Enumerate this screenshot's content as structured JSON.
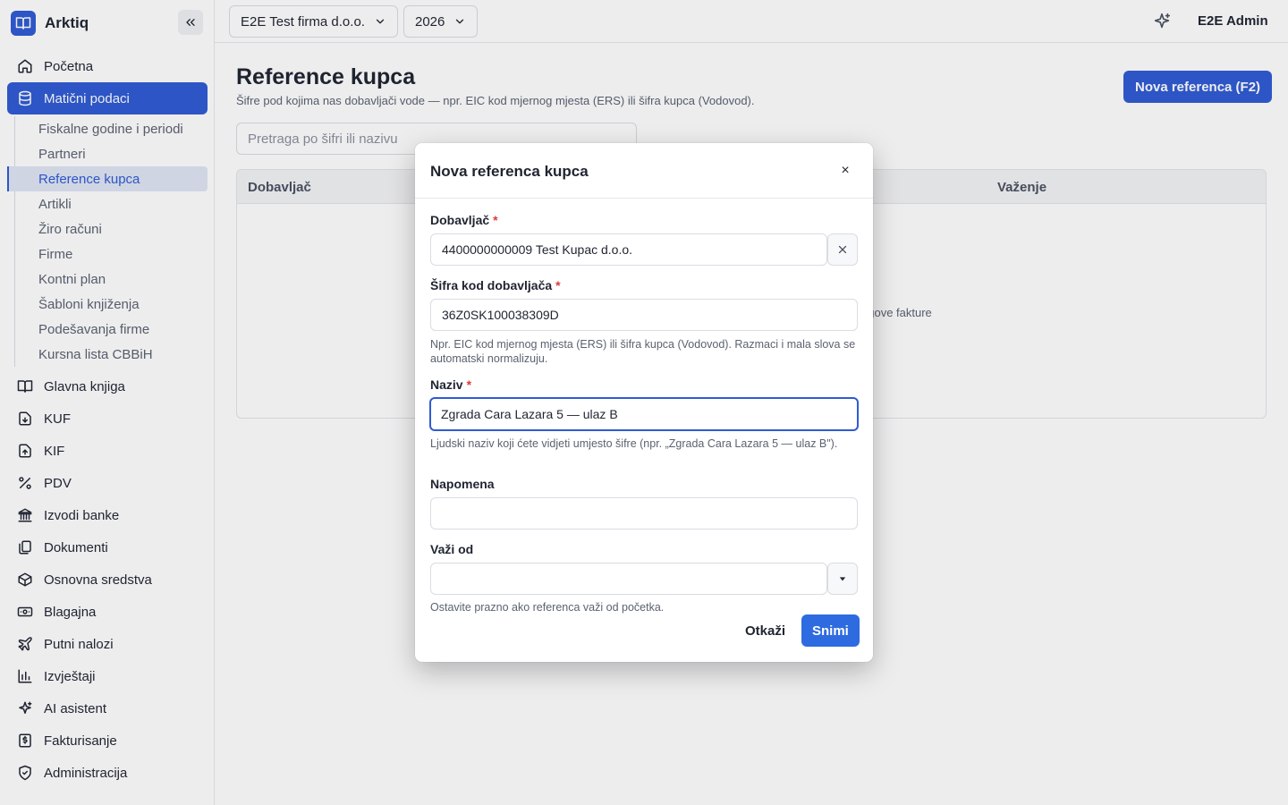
{
  "app": {
    "name": "Arktiq"
  },
  "topbar": {
    "company": "E2E Test firma d.o.o.",
    "year": "2026",
    "user": "E2E Admin"
  },
  "sidebar": {
    "items": [
      {
        "label": "Početna",
        "icon": "home-icon"
      },
      {
        "label": "Matični podaci",
        "icon": "database-icon",
        "active": true
      },
      {
        "label": "Glavna knjiga",
        "icon": "book-icon"
      },
      {
        "label": "KUF",
        "icon": "file-in-icon"
      },
      {
        "label": "KIF",
        "icon": "file-out-icon"
      },
      {
        "label": "PDV",
        "icon": "percent-icon"
      },
      {
        "label": "Izvodi banke",
        "icon": "bank-icon"
      },
      {
        "label": "Dokumenti",
        "icon": "documents-icon"
      },
      {
        "label": "Osnovna sredstva",
        "icon": "box-icon"
      },
      {
        "label": "Blagajna",
        "icon": "cash-icon"
      },
      {
        "label": "Putni nalozi",
        "icon": "plane-icon"
      },
      {
        "label": "Izvještaji",
        "icon": "chart-icon"
      },
      {
        "label": "AI asistent",
        "icon": "sparkle-icon"
      },
      {
        "label": "Fakturisanje",
        "icon": "invoice-icon"
      },
      {
        "label": "Administracija",
        "icon": "shield-icon"
      }
    ],
    "subitems": [
      {
        "label": "Fiskalne godine i periodi"
      },
      {
        "label": "Partneri"
      },
      {
        "label": "Reference kupca",
        "active": true
      },
      {
        "label": "Artikli"
      },
      {
        "label": "Žiro računi"
      },
      {
        "label": "Firme"
      },
      {
        "label": "Kontni plan"
      },
      {
        "label": "Šabloni knjiženja"
      },
      {
        "label": "Podešavanja firme"
      },
      {
        "label": "Kursna lista CBBiH"
      }
    ]
  },
  "page": {
    "title": "Reference kupca",
    "subtitle": "Šifre pod kojima nas dobavljači vode — npr. EIC kod mjernog mjesta (ERS) ili šifra kupca (Vodovod).",
    "new_button": "Nova referenca (F2)",
    "search_placeholder": "Pretraga po šifri ili nazivu",
    "table": {
      "col_supplier": "Dobavljač",
      "col_validity": "Važenje",
      "empty_fragment": "egove fakture"
    }
  },
  "modal": {
    "title": "Nova referenca kupca",
    "close": "×",
    "supplier_label": "Dobavljač",
    "supplier_value": "4400000000009 Test Kupac d.o.o.",
    "code_label": "Šifra kod dobavljača",
    "code_value": "36Z0SK100038309D",
    "code_hint": "Npr. EIC kod mjernog mjesta (ERS) ili šifra kupca (Vodovod). Razmaci i mala slova se automatski normalizuju.",
    "name_label": "Naziv",
    "name_value": "Zgrada Cara Lazara 5 — ulaz B",
    "name_hint": "Ljudski naziv koji ćete vidjeti umjesto šifre (npr. „Zgrada Cara Lazara 5 — ulaz B\").",
    "note_label": "Napomena",
    "note_value": "",
    "valid_from_label": "Važi od",
    "valid_from_value": "",
    "valid_from_hint": "Ostavite prazno ako referenca važi od početka.",
    "required_mark": "*",
    "cancel": "Otkaži",
    "save": "Snimi"
  }
}
